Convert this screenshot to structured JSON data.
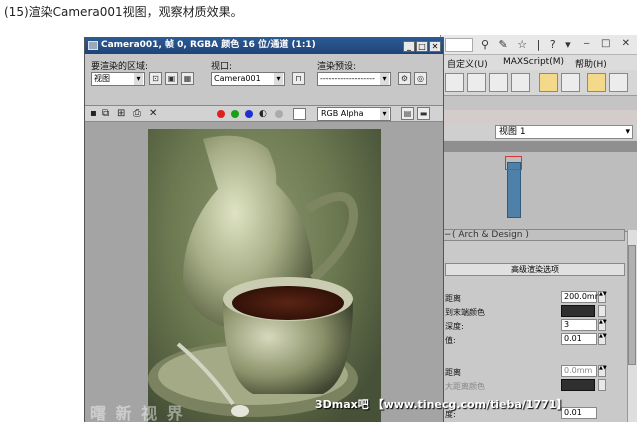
{
  "caption": "(15)渲染Camera001视图，观察材质效果。",
  "render_window": {
    "title": "Camera001, 帧 0, RGBA 颜色 16 位/通道 (1:1)",
    "controls": {
      "area_label": "要渲染的区域:",
      "area_value": "视图",
      "viewport_label": "视口:",
      "viewport_value": "Camera001",
      "preset_label": "渲染预设:",
      "preset_value": "-------------------"
    },
    "channel_value": "RGB Alpha",
    "colors": {
      "red": "#e02020",
      "green": "#18a018",
      "blue": "#2030d0"
    }
  },
  "max_app": {
    "menu": [
      "自定义(U)",
      "MAXScript(M)",
      "帮助(H)"
    ],
    "view_select": "视图 1",
    "rollout_title": "( Arch & Design )",
    "section_title": "高级渲染选项",
    "params": {
      "距离_label": "距离",
      "距离_value": "200.0mm",
      "end_color_label": "到末端颜色",
      "depth_label": "深度:",
      "depth_value": "3",
      "fall_label": "值:",
      "fall_value": "0.01",
      "dist2_label": "距离",
      "dist2_value": "0.0mm",
      "maxcolor_label": "大距离颜色",
      "tiny_label": "度:",
      "tiny_value": "0.01"
    }
  },
  "watermark": "3Dmax吧 【www.tinecg.com/tieba/1771】",
  "watermark_left": "曙 新 视 界"
}
